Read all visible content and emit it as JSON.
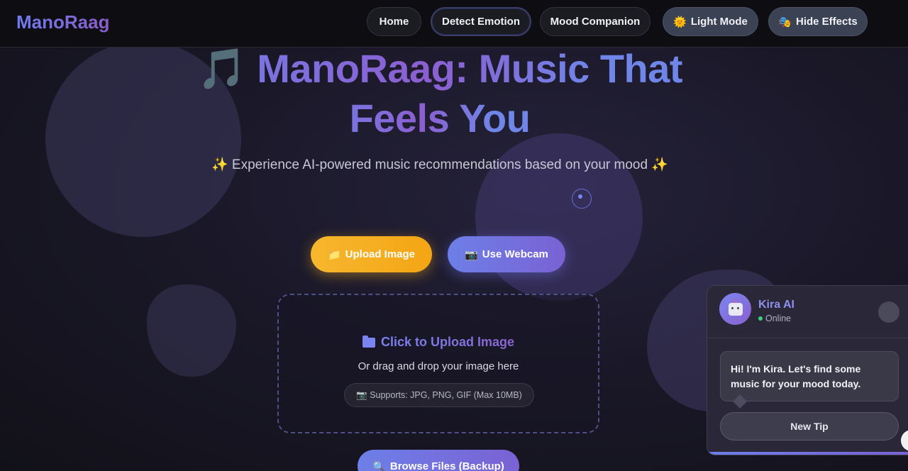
{
  "navbar": {
    "brand": "ManoRaag",
    "home": "Home",
    "detect": "Detect Emotion",
    "mood": "Mood Companion",
    "light_icon": "🌞",
    "light": "Light Mode",
    "effects_icon": "🎭",
    "effects": "Hide Effects"
  },
  "hero": {
    "note_icon": "🎵",
    "title_line1": "ManoRaag: Music That",
    "title_line2": "Feels You",
    "subtitle": "✨ Experience AI-powered music recommendations based on your mood ✨"
  },
  "actions": {
    "upload_icon": "📁",
    "upload": "Upload Image",
    "webcam_icon": "📷",
    "webcam": "Use Webcam"
  },
  "dropzone": {
    "title": "Click to Upload Image",
    "subtitle": "Or drag and drop your image here",
    "supports": "📷 Supports: JPG, PNG, GIF (Max 10MB)"
  },
  "browse": {
    "icon": "🔍",
    "label": "Browse Files (Backup)"
  },
  "chat": {
    "name": "Kira AI",
    "status": "Online",
    "message": "Hi! I'm Kira. Let's find some music for your mood today.",
    "tip_button": "New Tip"
  }
}
